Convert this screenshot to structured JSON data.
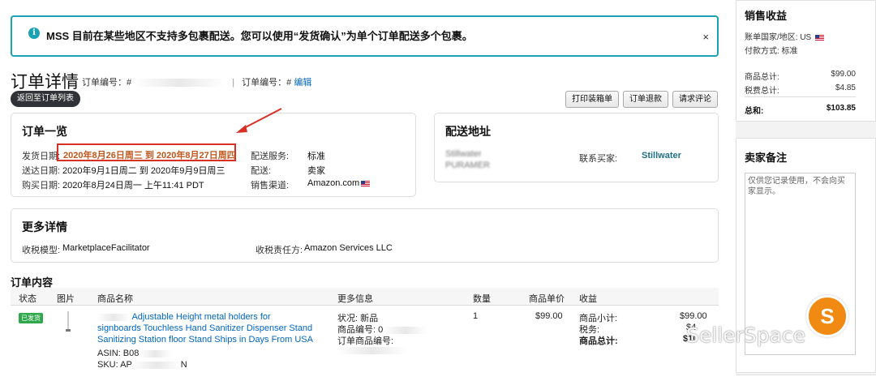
{
  "alert": {
    "message": "MSS 目前在某些地区不支持多包裹配送。您可以使用“发货确认”为单个订单配送多个包裹。",
    "close": "×"
  },
  "header": {
    "title": "订单详情",
    "order_label": "订单编号：#",
    "order2_label": "订单编号：#",
    "edit": "编辑",
    "back": "返回至订单列表",
    "actions": [
      "打印装箱单",
      "订单退款",
      "请求评论"
    ]
  },
  "summary": {
    "heading": "订单一览",
    "ship_date_label": "发货日期:",
    "ship_date_value": "2020年8月26日周三 到 2020年8月27日周四",
    "deliver_label": "送达日期:",
    "deliver_value": "2020年9月1日周二 到 2020年9月9日周三",
    "purchase_label": "购买日期:",
    "purchase_value": "2020年8月24日周一 上午11:41 PDT",
    "service_label": "配送服务:",
    "service_value": "标准",
    "fulfill_label": "配送:",
    "fulfill_value": "卖家",
    "channel_label": "销售渠道:",
    "channel_value": "Amazon.com"
  },
  "address": {
    "heading": "配送地址",
    "line1": "Stillwater",
    "line2": "PURAMER",
    "contact_label": "联系买家:",
    "contact_value": "Stillwater"
  },
  "more": {
    "heading": "更多详情",
    "tax_model_label": "收税模型:",
    "tax_model_value": "MarketplaceFacilitator",
    "tax_resp_label": "收税责任方:",
    "tax_resp_value": "Amazon Services LLC"
  },
  "contents": {
    "heading": "订单内容",
    "columns": [
      "状态",
      "图片",
      "商品名称",
      "更多信息",
      "数量",
      "商品单价",
      "收益"
    ],
    "row": {
      "badge": "已发货",
      "name": "Adjustable Height metal holders for signboards Touchless Hand Sanitizer Dispenser Stand Sanitizing Station floor Stand Ships in Days From USA",
      "asin": "ASIN: B08",
      "sku": "SKU: AP",
      "sku_tail": "N",
      "status": "状况: 新品",
      "item_no": "商品编号: 0",
      "order_item_no": "订单商品编号:",
      "qty": "1",
      "price": "$99.00",
      "subtotal_label": "商品小计:",
      "subtotal": "$99.00",
      "tax_label": "税务:",
      "tax": "$4",
      "total_label": "商品总计:",
      "total": "$10"
    }
  },
  "sidebar": {
    "revenue_heading": "销售收益",
    "country": "账单国家/地区: US",
    "payment": "付款方式: 标准",
    "items_label": "商品总计:",
    "items_value": "$99.00",
    "tax_label": "税费总计:",
    "tax_value": "$4.85",
    "total_label": "总和:",
    "total_value": "$103.85",
    "notes_heading": "卖家备注",
    "notes_placeholder": "仅供您记录使用，不会向买家显示。"
  },
  "watermark": "SellerSpace",
  "colors": {
    "accent": "#1aa3b5",
    "highlight": "#d93025",
    "link": "#0066c0",
    "badge": "#2ea84b"
  }
}
